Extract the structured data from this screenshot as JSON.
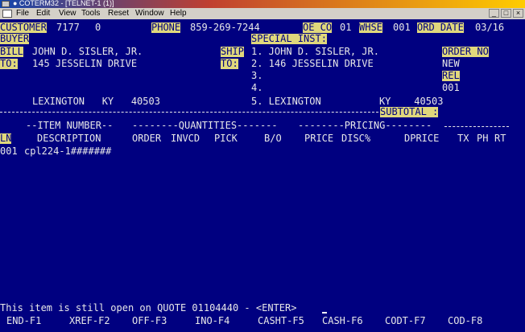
{
  "window": {
    "title": "● COTERM32 - [TELNET-1 (1)]",
    "menu": [
      "File",
      "Edit",
      "View",
      "Tools",
      "Reset",
      "Window",
      "Help"
    ]
  },
  "header": {
    "customer_label": "CUSTOMER",
    "customer_no": "7177",
    "customer_suffix": "0",
    "phone_label": "PHONE",
    "phone": "859-269-7244",
    "oe_co_label": "OE CO",
    "oe_co": "01",
    "whse_label": "WHSE",
    "whse": "001",
    "ord_date_label": "ORD DATE",
    "ord_date": "03/16"
  },
  "buyer_label": "BUYER",
  "special_inst_label": "SPECIAL INST:",
  "bill_to": {
    "label_line1": "BILL",
    "label_line2": "TO:",
    "name": "JOHN D. SISLER, JR.",
    "address": "145 JESSELIN DRIVE",
    "city_line": "LEXINGTON   KY   40503"
  },
  "ship_to": {
    "label_line1": "SHIP",
    "label_line2": "TO:",
    "lines": [
      "1. JOHN D. SISLER, JR.",
      "2. 146 JESSELIN DRIVE",
      "3.",
      "4.",
      "5. LEXINGTON          KY    40503"
    ]
  },
  "order": {
    "order_no_label": "ORDER NO",
    "status": "NEW",
    "rel_label": "REL",
    "rel_value": "001"
  },
  "subtotal_label": "SUBTOTAL :",
  "columns": {
    "item_number_group": "--ITEM NUMBER--",
    "quantities_group": "--------QUANTITIES-------",
    "pricing_group": "--------PRICING--------",
    "ln": "LN",
    "description": "DESCRIPTION",
    "order": "ORDER",
    "invcd": "INVCD",
    "pick": "PICK",
    "bo": "B/O",
    "price": "PRICE",
    "disc": "DISC%",
    "dprice": "DPRICE",
    "tx": "TX",
    "ph": "PH",
    "rt": "RT"
  },
  "line_items": [
    {
      "ln": "001",
      "item": "cpl224-1#######"
    }
  ],
  "status_message": "This item is still open on QUOTE 01104440 - <ENTER>",
  "function_keys": [
    "END-F1",
    "XREF-F2",
    "OFF-F3",
    "INO-F4",
    "CASHT-F5",
    "CASH-F6",
    "CODT-F7",
    "COD-F8"
  ],
  "colors": {
    "screen_bg": "#000080",
    "field_highlight": "#e0d87c",
    "text": "#e8e8e8"
  }
}
